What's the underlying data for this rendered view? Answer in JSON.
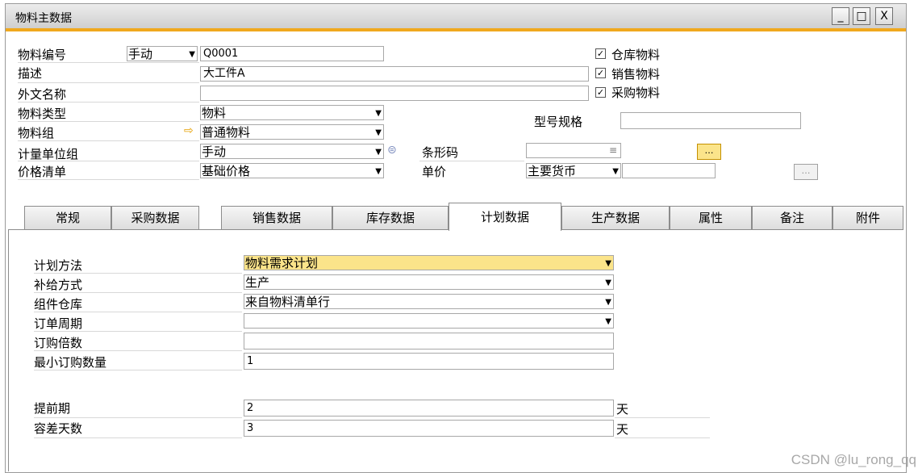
{
  "window": {
    "title": "物料主数据",
    "minimize": "_",
    "maximize": "□",
    "close": "X"
  },
  "header": {
    "item_no_label": "物料编号",
    "item_no_mode": "手动",
    "item_no_value": "Q0001",
    "desc_label": "描述",
    "desc_value": "大工件A",
    "foreign_name_label": "外文名称",
    "foreign_name_value": "",
    "item_type_label": "物料类型",
    "item_type_value": "物料",
    "item_group_label": "物料组",
    "item_group_value": "普通物料",
    "uom_group_label": "计量单位组",
    "uom_group_value": "手动",
    "price_list_label": "价格清单",
    "price_list_value": "基础价格",
    "inventory_item_label": "仓库物料",
    "sales_item_label": "销售物料",
    "purchase_item_label": "采购物料",
    "checkmark": "✓",
    "model_spec_label": "型号规格",
    "model_spec_value": "",
    "barcode_label": "条形码",
    "barcode_value": "≡",
    "unit_price_label": "单价",
    "unit_price_currency": "主要货币",
    "unit_price_value": "",
    "ellipsis": "…"
  },
  "tabs": [
    {
      "label": "常规"
    },
    {
      "label": "采购数据"
    },
    {
      "label": "销售数据"
    },
    {
      "label": "库存数据"
    },
    {
      "label": "计划数据"
    },
    {
      "label": "生产数据"
    },
    {
      "label": "属性"
    },
    {
      "label": "备注"
    },
    {
      "label": "附件"
    }
  ],
  "planning": {
    "method_label": "计划方法",
    "method_value": "物料需求计划",
    "procurement_label": "补给方式",
    "procurement_value": "生产",
    "component_wh_label": "组件仓库",
    "component_wh_value": "来自物料清单行",
    "order_interval_label": "订单周期",
    "order_interval_value": "",
    "order_multiple_label": "订购倍数",
    "order_multiple_value": "",
    "min_order_qty_label": "最小订购数量",
    "min_order_qty_value": "1",
    "lead_time_label": "提前期",
    "lead_time_value": "2",
    "lead_time_unit": "天",
    "tolerance_days_label": "容差天数",
    "tolerance_days_value": "3",
    "tolerance_days_unit": "天"
  },
  "watermark": "CSDN @lu_rong_qq",
  "colors": {
    "accent": "#f0a81e",
    "highlight_field": "#fbe48a"
  }
}
